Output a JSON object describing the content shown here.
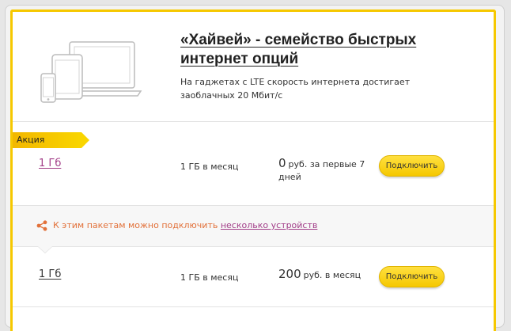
{
  "header": {
    "title": "«Хайвей» - семейство быстрых интернет опций",
    "subtitle": "На гаджетах с LTE скорость интернета достигает заоблачных 20 Мбит/с",
    "illustration_icon": "devices-icon"
  },
  "promo_tag": "Акция",
  "tariffs": [
    {
      "name": "1 Гб",
      "volume": "1 ГБ в месяц",
      "price_value": "0",
      "price_note": "руб. за первые 7 дней",
      "button": "Подключить"
    },
    {
      "name": "1 Гб",
      "volume": "1 ГБ в месяц",
      "price_value": "200",
      "price_note": "руб. в месяц",
      "button": "Подключить"
    }
  ],
  "notice": {
    "text": "К этим пакетам можно подключить",
    "link": "несколько устройств",
    "icon": "share-icon"
  },
  "colors": {
    "accent_yellow": "#f6c800",
    "link_purple": "#a23d88",
    "notice_orange": "#e2713a"
  }
}
